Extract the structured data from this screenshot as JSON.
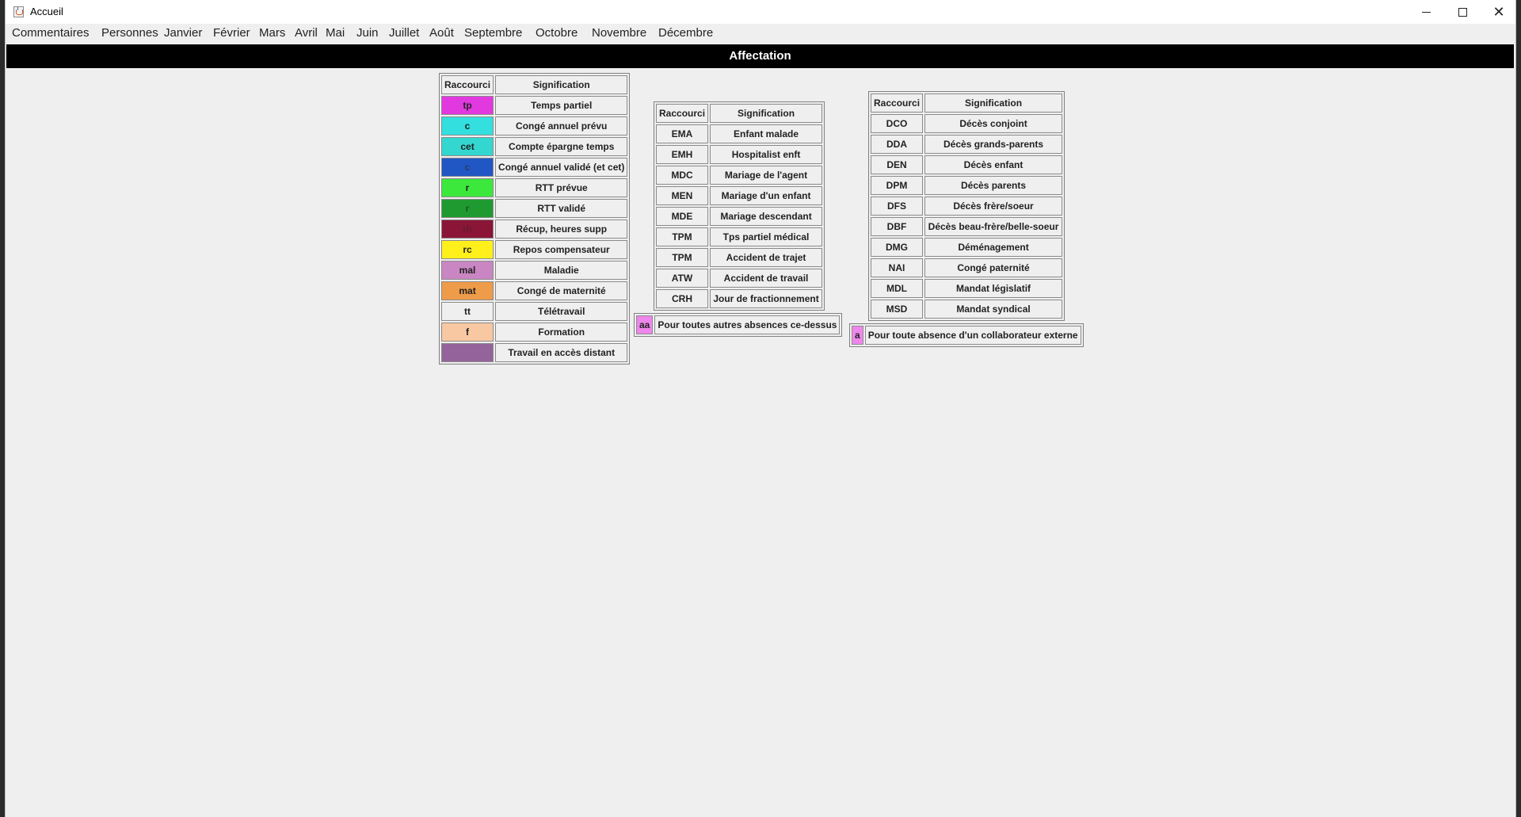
{
  "window": {
    "title": "Accueil"
  },
  "menu": [
    "Commentaires",
    "Personnes",
    "Janvier",
    "Février",
    "Mars",
    "Avril",
    "Mai",
    "Juin",
    "Juillet",
    "Août",
    "Septembre",
    "Octobre",
    "Novembre",
    "Décembre"
  ],
  "header": {
    "title": "Affectation"
  },
  "table1": {
    "headers": [
      "Raccourci",
      "Signification"
    ],
    "rows": [
      {
        "code": "tp",
        "label": "Temps partiel",
        "color": "#e238e0",
        "text_color": "#222"
      },
      {
        "code": "c",
        "label": "Congé annuel prévu",
        "color": "#33dfdf",
        "text_color": "#222"
      },
      {
        "code": "cet",
        "label": "Compte épargne temps",
        "color": "#33d7d0",
        "text_color": "#222"
      },
      {
        "code": "c",
        "label": "Congé annuel validé (et cet)",
        "color": "#2157c4",
        "text_color": "#2b3a66"
      },
      {
        "code": "r",
        "label": "RTT prévue",
        "color": "#3ce83c",
        "text_color": "#222"
      },
      {
        "code": "r",
        "label": "RTT validé",
        "color": "#1f9a30",
        "text_color": "#1d5a22"
      },
      {
        "code": "rh",
        "label": "Récup, heures supp",
        "color": "#8a1537",
        "text_color": "#6a1a2e"
      },
      {
        "code": "rc",
        "label": "Repos compensateur",
        "color": "#fff01c",
        "text_color": "#222"
      },
      {
        "code": "mal",
        "label": "Maladie",
        "color": "#c986c2",
        "text_color": "#222"
      },
      {
        "code": "mat",
        "label": "Congé de maternité",
        "color": "#ee9b4a",
        "text_color": "#222"
      },
      {
        "code": "tt",
        "label": "Télétravail",
        "color": "#efefef",
        "text_color": "#222"
      },
      {
        "code": "f",
        "label": "Formation",
        "color": "#f7c8a2",
        "text_color": "#222"
      },
      {
        "code": "",
        "label": "Travail en accès distant",
        "color": "#95639b",
        "text_color": "#222"
      }
    ]
  },
  "table2": {
    "headers": [
      "Raccourci",
      "Signification"
    ],
    "rows": [
      {
        "code": "EMA",
        "label": "Enfant malade"
      },
      {
        "code": "EMH",
        "label": "Hospitalist enft"
      },
      {
        "code": "MDC",
        "label": "Mariage de l'agent"
      },
      {
        "code": "MEN",
        "label": "Mariage d'un enfant"
      },
      {
        "code": "MDE",
        "label": "Mariage descendant"
      },
      {
        "code": "TPM",
        "label": "Tps partiel médical"
      },
      {
        "code": "TPM",
        "label": "Accident de trajet"
      },
      {
        "code": "ATW",
        "label": "Accident de travail"
      },
      {
        "code": "CRH",
        "label": "Jour de fractionnement"
      }
    ],
    "footer": {
      "code": "aa",
      "label": "Pour toutes autres absences ce-dessus",
      "color": "#ef86ec"
    }
  },
  "table3": {
    "headers": [
      "Raccourci",
      "Signification"
    ],
    "rows": [
      {
        "code": "DCO",
        "label": "Décès conjoint"
      },
      {
        "code": "DDA",
        "label": "Décès grands-parents"
      },
      {
        "code": "DEN",
        "label": "Décès enfant"
      },
      {
        "code": "DPM",
        "label": "Décès parents"
      },
      {
        "code": "DFS",
        "label": "Décès frère/soeur"
      },
      {
        "code": "DBF",
        "label": "Décès beau-frère/belle-soeur"
      },
      {
        "code": "DMG",
        "label": "Déménagement"
      },
      {
        "code": "NAI",
        "label": "Congé paternité"
      },
      {
        "code": "MDL",
        "label": "Mandat législatif"
      },
      {
        "code": "MSD",
        "label": "Mandat syndical"
      }
    ],
    "footer": {
      "code": "a",
      "label": "Pour toute absence d'un collaborateur externe",
      "color": "#ef86ec"
    }
  }
}
